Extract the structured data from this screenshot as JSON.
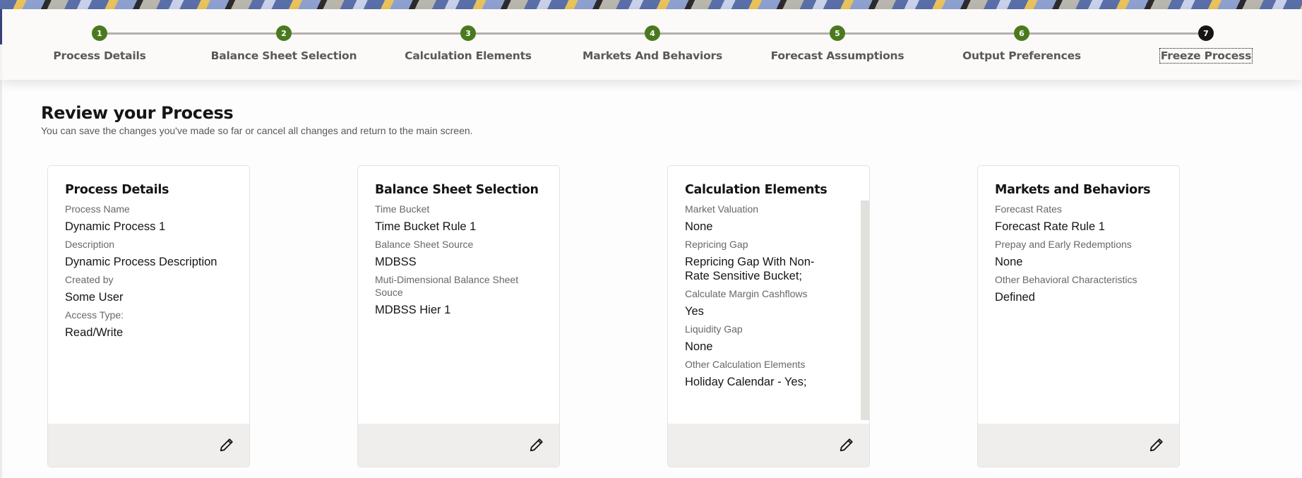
{
  "stepper": {
    "steps": [
      {
        "number": "1",
        "label": "Process Details",
        "state": "completed"
      },
      {
        "number": "2",
        "label": "Balance Sheet Selection",
        "state": "completed"
      },
      {
        "number": "3",
        "label": "Calculation Elements",
        "state": "completed"
      },
      {
        "number": "4",
        "label": "Markets And Behaviors",
        "state": "completed"
      },
      {
        "number": "5",
        "label": "Forecast Assumptions",
        "state": "completed"
      },
      {
        "number": "6",
        "label": "Output Preferences",
        "state": "completed"
      },
      {
        "number": "7",
        "label": "Freeze Process",
        "state": "current"
      }
    ],
    "colors": {
      "completed": "#4b7a1e",
      "current": "#161513"
    }
  },
  "header": {
    "title": "Review your Process",
    "subtitle": "You can save the changes you've made so far or cancel all changes and return to the main screen."
  },
  "cards": [
    {
      "title": "Process Details",
      "fields": [
        {
          "label": "Process Name",
          "value": "Dynamic Process 1"
        },
        {
          "label": "Description",
          "value": "Dynamic Process Description"
        },
        {
          "label": "Created by",
          "value": "Some User"
        },
        {
          "label": "Access Type:",
          "value": "Read/Write"
        }
      ],
      "edit_icon": "pencil-icon"
    },
    {
      "title": "Balance Sheet Selection",
      "fields": [
        {
          "label": "Time Bucket",
          "value": "Time Bucket Rule 1"
        },
        {
          "label": "Balance Sheet Source",
          "value": "MDBSS"
        },
        {
          "label": "Muti-Dimensional Balance Sheet Souce",
          "value": "MDBSS Hier 1"
        }
      ],
      "edit_icon": "pencil-icon"
    },
    {
      "title": "Calculation Elements",
      "fields": [
        {
          "label": "Market Valuation",
          "value": "None"
        },
        {
          "label": "Repricing Gap",
          "value": "Repricing Gap With Non-Rate Sensitive Bucket;"
        },
        {
          "label": "Calculate Margin Cashflows",
          "value": "Yes"
        },
        {
          "label": "Liquidity Gap",
          "value": "None"
        },
        {
          "label": "Other Calculation Elements",
          "value": "Holiday Calendar - Yes;"
        }
      ],
      "edit_icon": "pencil-icon",
      "scrollable": true
    },
    {
      "title": "Markets and Behaviors",
      "fields": [
        {
          "label": "Forecast Rates",
          "value": "Forecast Rate Rule 1"
        },
        {
          "label": "Prepay and Early Redemptions",
          "value": "None"
        },
        {
          "label": "Other Behavioral Characteristics",
          "value": "Defined"
        }
      ],
      "edit_icon": "pencil-icon"
    }
  ]
}
